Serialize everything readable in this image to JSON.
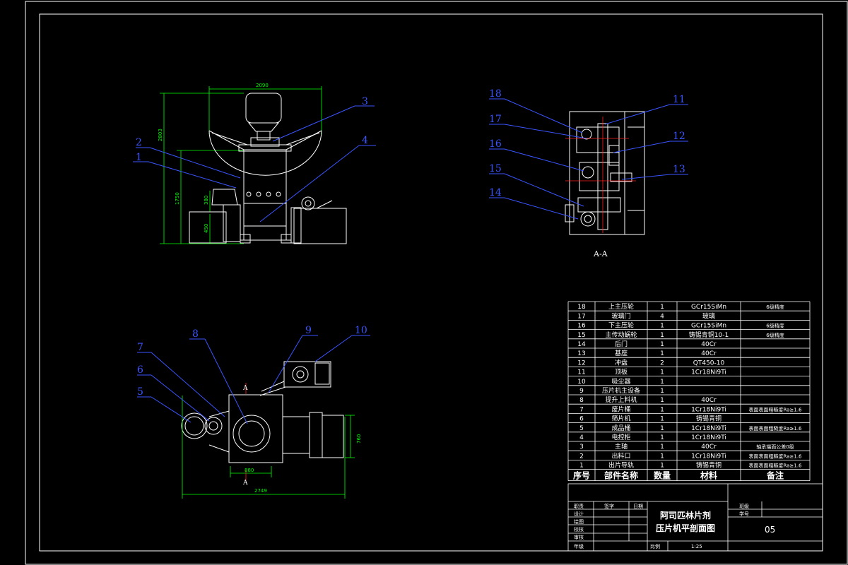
{
  "views": {
    "front": {
      "width_dim": "2090",
      "height_dim": "2803",
      "sub_height_dim": "1750",
      "dim_a": "380",
      "dim_b": "450",
      "callouts": [
        "1",
        "2",
        "3",
        "4"
      ]
    },
    "section": {
      "label": "A-A",
      "callouts": [
        "18",
        "17",
        "16",
        "15",
        "14",
        "11",
        "12",
        "13"
      ]
    },
    "plan": {
      "dim_width": "2749",
      "dim_small": "880",
      "dim_height": "760",
      "section_mark": "A",
      "callouts": [
        "5",
        "6",
        "7",
        "8",
        "9",
        "10"
      ]
    }
  },
  "parts_list": {
    "rows": [
      {
        "no": "18",
        "name": "上主压轮",
        "qty": "1",
        "material": "GCr15SiMn",
        "note": "6级精度"
      },
      {
        "no": "17",
        "name": "玻璃门",
        "qty": "4",
        "material": "玻璃",
        "note": ""
      },
      {
        "no": "16",
        "name": "下主压轮",
        "qty": "1",
        "material": "GCr15SiMn",
        "note": "6级精度"
      },
      {
        "no": "15",
        "name": "主传动蜗轮",
        "qty": "1",
        "material": "铸锡青铜10-1",
        "note": "6级精度"
      },
      {
        "no": "14",
        "name": "后门",
        "qty": "1",
        "material": "40Cr",
        "note": ""
      },
      {
        "no": "13",
        "name": "基座",
        "qty": "1",
        "material": "40Cr",
        "note": ""
      },
      {
        "no": "12",
        "name": "冲盘",
        "qty": "2",
        "material": "QT450-10",
        "note": ""
      },
      {
        "no": "11",
        "name": "顶板",
        "qty": "1",
        "material": "1Cr18Ni9Ti",
        "note": ""
      },
      {
        "no": "10",
        "name": "吸尘器",
        "qty": "1",
        "material": "",
        "note": ""
      },
      {
        "no": "9",
        "name": "压片机主设备",
        "qty": "1",
        "material": "",
        "note": ""
      },
      {
        "no": "8",
        "name": "提升上料机",
        "qty": "1",
        "material": "40Cr",
        "note": ""
      },
      {
        "no": "7",
        "name": "废片桶",
        "qty": "1",
        "material": "1Cr18Ni9Ti",
        "note": "表面表面粗糙度Ra≥1.6"
      },
      {
        "no": "6",
        "name": "筛片机",
        "qty": "1",
        "material": "铸锡青铜",
        "note": ""
      },
      {
        "no": "5",
        "name": "成品桶",
        "qty": "1",
        "material": "1Cr18Ni9Ti",
        "note": "表面表面粗糙度Ra≥1.6"
      },
      {
        "no": "4",
        "name": "电控柜",
        "qty": "1",
        "material": "1Cr18Ni9Ti",
        "note": ""
      },
      {
        "no": "3",
        "name": "主轴",
        "qty": "1",
        "material": "40Cr",
        "note": "轴承端面公差0级"
      },
      {
        "no": "2",
        "name": "出料口",
        "qty": "1",
        "material": "1Cr18Ni9Ti",
        "note": "表面表面粗糙度Ra≥1.6"
      },
      {
        "no": "1",
        "name": "出片导轨",
        "qty": "1",
        "material": "铸锡青铜",
        "note": "表面表面粗糙度Ra≥1.6"
      }
    ],
    "headers": {
      "no": "序号",
      "name": "部件名称",
      "qty": "数量",
      "material": "材料",
      "note": "备注"
    }
  },
  "title_block": {
    "roles": [
      "设计",
      "绘图",
      "校核",
      "审核",
      "年级"
    ],
    "header_labels": [
      "职责",
      "签字",
      "日期"
    ],
    "drawing_title_line1": "阿司匹林片剂",
    "drawing_title_line2": "压片机平剖面图",
    "class_label": "班级",
    "student_id_label": "学号",
    "sheet_no": "05",
    "scale_label": "比例",
    "scale_value": "1:25"
  }
}
